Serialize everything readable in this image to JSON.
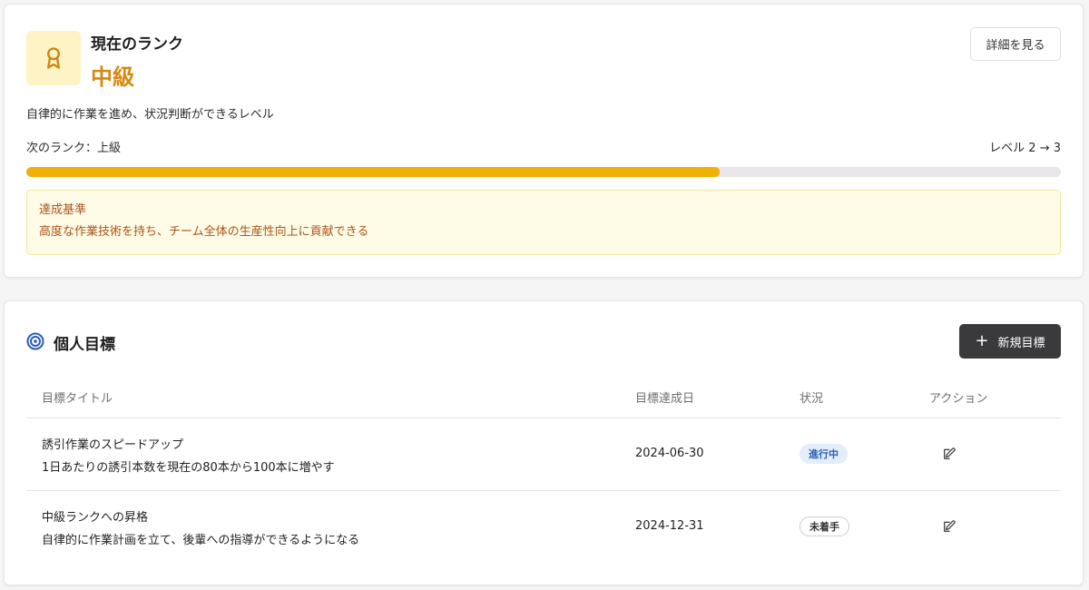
{
  "rank": {
    "label": "現在のランク",
    "value": "中級",
    "detail_button": "詳細を見る",
    "description": "自律的に作業を進め、状況判断ができるレベル",
    "next_rank": "次のランク：上級",
    "level_progress": "レベル 2 → 3",
    "progress_percent": 67,
    "criteria_title": "達成基準",
    "criteria_text": "高度な作業技術を持ち、チーム全体の生産性向上に貢献できる",
    "icon": "award-ribbon-icon"
  },
  "goals": {
    "title": "個人目標",
    "icon": "target-icon",
    "new_button": "新規目標",
    "columns": [
      "目標タイトル",
      "目標達成日",
      "状況",
      "アクション"
    ],
    "rows": [
      {
        "title": "誘引作業のスピードアップ",
        "description": "1日あたりの誘引本数を現在の80本から100本に増やす",
        "date": "2024-06-30",
        "status": "進行中"
      },
      {
        "title": "中級ランクへの昇格",
        "description": "自律的に作業計画を立て、後輩への指導ができるようになる",
        "date": "2024-12-31",
        "status": "未着手"
      }
    ]
  },
  "colors": {
    "accent_gold": "#f0b106",
    "rank_text": "#d68910",
    "criteria_text": "#a9561a",
    "badge_progress_bg": "#e3edfb",
    "badge_progress_text": "#2a5cb8",
    "dark_button": "#3a3a3c"
  }
}
